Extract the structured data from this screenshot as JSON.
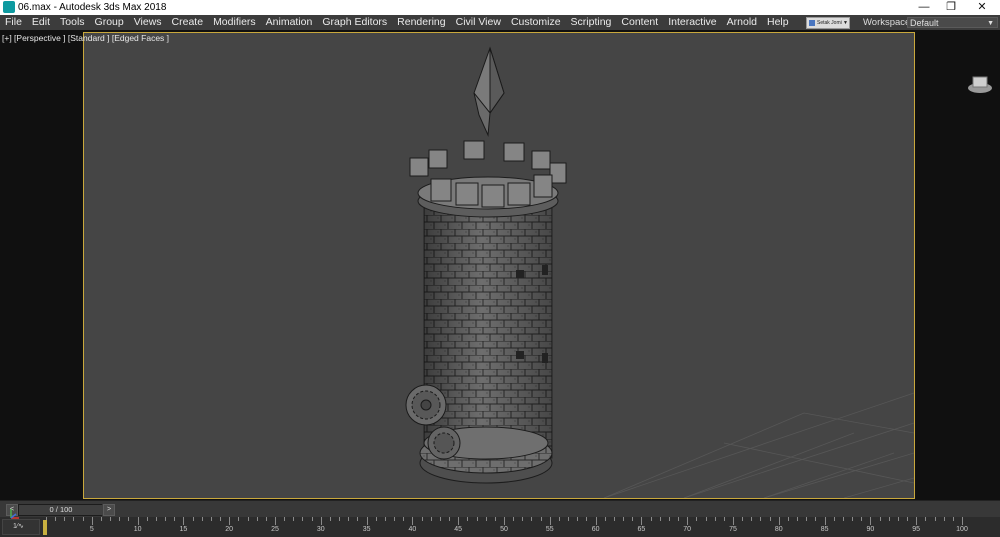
{
  "window": {
    "title": "06.max - Autodesk 3ds Max 2018",
    "controls": [
      "—",
      "❐",
      "✕"
    ]
  },
  "menu": [
    "File",
    "Edit",
    "Tools",
    "Group",
    "Views",
    "Create",
    "Modifiers",
    "Animation",
    "Graph Editors",
    "Rendering",
    "Civil View",
    "Customize",
    "Scripting",
    "Content",
    "Interactive",
    "Arnold",
    "Help"
  ],
  "user": {
    "name": "Setak Jomi"
  },
  "workspaces": {
    "label": "Workspaces:",
    "value": "Default"
  },
  "viewport": {
    "label": "[+] [Perspective ] [Standard ] [Edged Faces ]",
    "accent": "#c9a83c",
    "scene_object": "castle-tower-mesh"
  },
  "time_slider": {
    "text": "0 / 100",
    "prev": "<",
    "next": ">",
    "current_frame": 0,
    "total_frames": 100
  },
  "trackbar": {
    "button_label": "1⁄∿",
    "labels": [
      "5",
      "10",
      "15",
      "20",
      "25",
      "30",
      "35",
      "40",
      "45",
      "50",
      "55",
      "60",
      "65",
      "70",
      "75",
      "80",
      "85",
      "90",
      "95",
      "100"
    ]
  }
}
